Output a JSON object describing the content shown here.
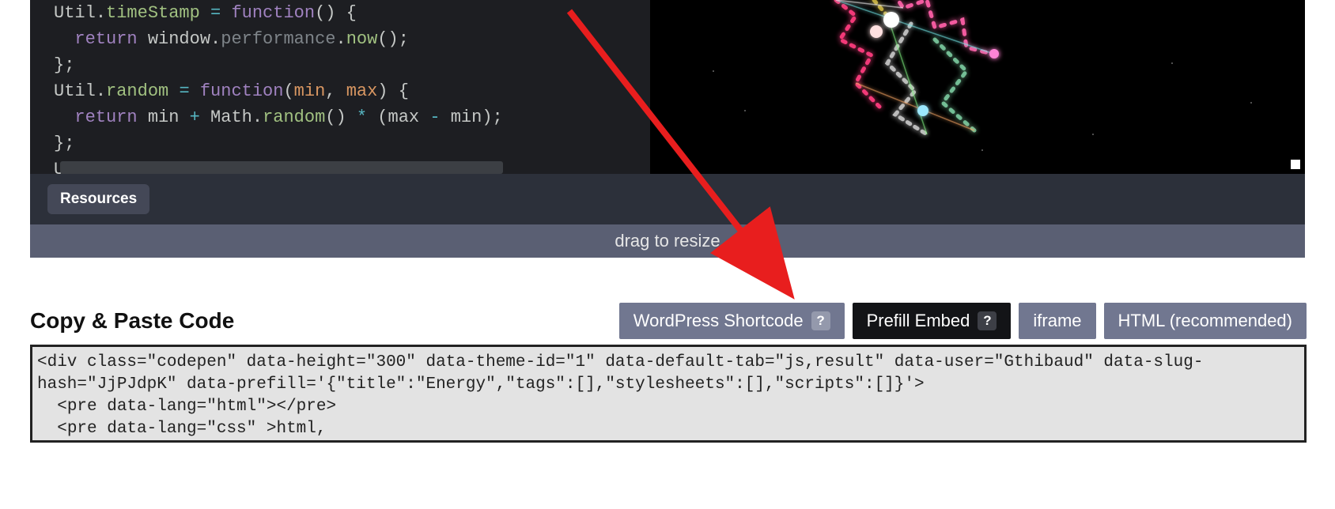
{
  "code_editor": {
    "lines_html": [
      "<span class='tok-obj'>Util</span><span class='tok-punc'>.</span><span class='tok-prop'>timeStamp</span> <span class='tok-op'>=</span> <span class='tok-kw'>function</span><span class='tok-punc'>() {</span>",
      "  <span class='tok-kw'>return</span> <span class='tok-obj'>window</span><span class='tok-punc'>.</span><span class='tok-dim'>performance</span><span class='tok-punc'>.</span><span class='tok-func'>now</span><span class='tok-punc'>();</span>",
      "<span class='tok-punc'>};</span>",
      "<span class='tok-obj'>Util</span><span class='tok-punc'>.</span><span class='tok-prop'>random</span> <span class='tok-op'>=</span> <span class='tok-kw'>function</span><span class='tok-punc'>(</span><span class='tok-param'>min</span><span class='tok-punc'>, </span><span class='tok-param'>max</span><span class='tok-punc'>) {</span>",
      "  <span class='tok-kw'>return</span> <span class='tok-obj'>min</span> <span class='tok-op'>+</span> <span class='tok-obj'>Math</span><span class='tok-punc'>.</span><span class='tok-func'>random</span><span class='tok-punc'>()</span> <span class='tok-op'>*</span> <span class='tok-punc'>(</span><span class='tok-obj'>max</span> <span class='tok-op'>-</span> <span class='tok-obj'>min</span><span class='tok-punc'>);</span>",
      "<span class='tok-punc'>};</span>",
      "<span class='tok-obj'>Util</span><span class='tok-punc'>.</span><span class='tok-prop'>map</span> <span class='tok-op'>=</span> <span class='tok-kw'>function</span><span class='tok-punc'>(</span><span class='tok-param'>a</span><span class='tok-punc'>, </span><span class='tok-param'>b</span><span class='tok-punc'>, </span><span class='tok-param'>c</span><span class='tok-punc'>, </span><span class='tok-param'>d</span><span class='tok-punc'>, </span><span class='tok-param'>e</span><span class='tok-punc'>) {</span>"
    ]
  },
  "footer": {
    "resources_label": "Resources"
  },
  "drag_bar": {
    "label": "drag to resize"
  },
  "copy_paste": {
    "heading": "Copy & Paste Code",
    "tabs": [
      {
        "label": "WordPress Shortcode",
        "help": "?",
        "active": false
      },
      {
        "label": "Prefill Embed",
        "help": "?",
        "active": true
      },
      {
        "label": "iframe",
        "help": null,
        "active": false
      },
      {
        "label": "HTML (recommended)",
        "help": null,
        "active": false
      }
    ],
    "code": "<div class=\"codepen\" data-height=\"300\" data-theme-id=\"1\" data-default-tab=\"js,result\" data-user=\"Gthibaud\" data-slug-hash=\"JjPJdpK\" data-prefill='{\"title\":\"Energy\",\"tags\":[],\"stylesheets\":[],\"scripts\":[]}'>\n  <pre data-lang=\"html\"></pre>\n  <pre data-lang=\"css\" >html,"
  },
  "annotation": {
    "arrow_color": "#e81e1e"
  }
}
